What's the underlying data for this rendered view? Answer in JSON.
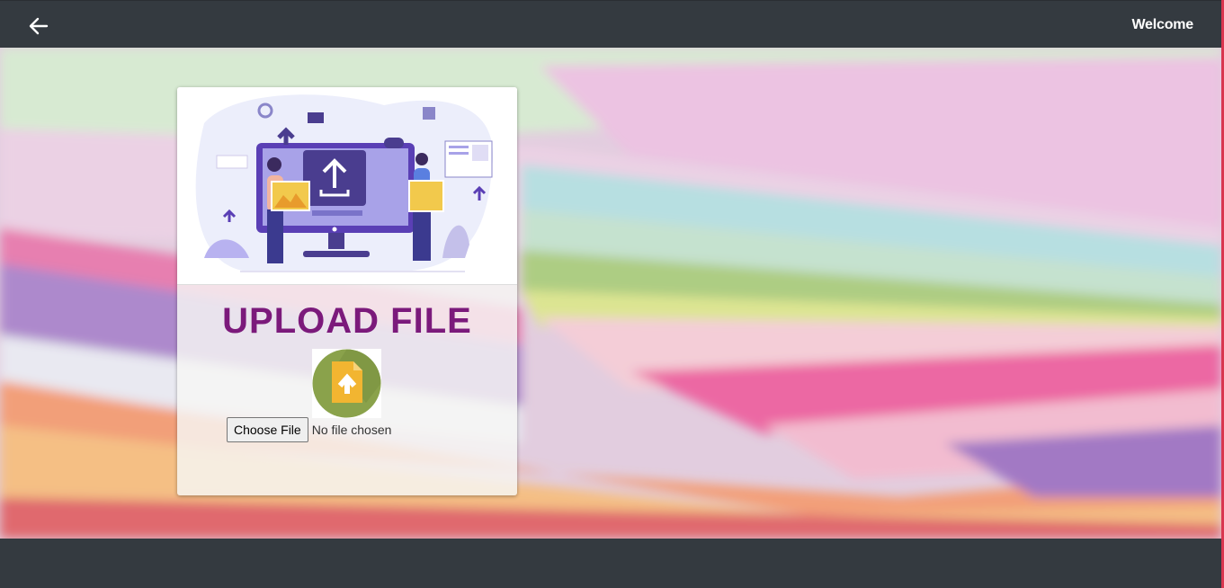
{
  "header": {
    "back_icon": "arrow-left-icon",
    "welcome_text": "Welcome"
  },
  "card": {
    "title": "UPLOAD FILE",
    "upload_icon": "file-upload-icon",
    "file_input": {
      "button_label": "Choose File",
      "status_text": "No file chosen"
    }
  },
  "colors": {
    "topbar": "#343a40",
    "title": "#7b1a7b",
    "icon_circle": "#8aa24b",
    "icon_file": "#f2b531",
    "accent_border": "#d9364f"
  }
}
